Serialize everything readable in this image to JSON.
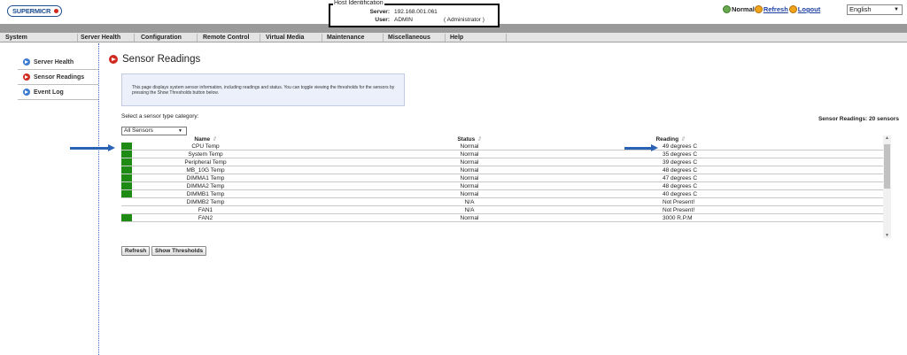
{
  "header": {
    "logo_text": "SUPERMICR",
    "host_box": {
      "legend": "Host Identification",
      "server_label": "Server:",
      "server_value": "192.168.001.061",
      "user_label": "User:",
      "user_value": "ADMIN",
      "user_role": "( Administrator )"
    },
    "status_text": "Normal",
    "refresh_label": "Refresh",
    "logout_label": "Logout",
    "language": "English"
  },
  "nav": [
    "System",
    "Server Health",
    "Configuration",
    "Remote Control",
    "Virtual Media",
    "Maintenance",
    "Miscellaneous",
    "Help"
  ],
  "sidebar": {
    "items": [
      {
        "label": "Server Health",
        "icon": "blue-arrow-icon",
        "active": false
      },
      {
        "label": "Sensor Readings",
        "icon": "red-arrow-icon",
        "active": true
      },
      {
        "label": "Event Log",
        "icon": "blue-arrow-icon",
        "active": false
      }
    ]
  },
  "main": {
    "title": "Sensor Readings",
    "info_text": "This page displays system sensor information, including readings and status. You can toggle viewing the thresholds for the sensors by pressing the Show Thresholds button below.",
    "category_label": "Select a sensor type category:",
    "category_selected": "All Sensors",
    "sensor_count": "Sensor Readings: 20 sensors",
    "columns": {
      "name": "Name",
      "status": "Status",
      "reading": "Reading",
      "sort_icon": "⇕"
    },
    "rows": [
      {
        "name": "CPU Temp",
        "status": "Normal",
        "reading": "49 degrees C",
        "indicator": "green"
      },
      {
        "name": "System Temp",
        "status": "Normal",
        "reading": "35 degrees C",
        "indicator": "green"
      },
      {
        "name": "Peripheral Temp",
        "status": "Normal",
        "reading": "39 degrees C",
        "indicator": "green"
      },
      {
        "name": "MB_10G Temp",
        "status": "Normal",
        "reading": "48 degrees C",
        "indicator": "green"
      },
      {
        "name": "DIMMA1 Temp",
        "status": "Normal",
        "reading": "47 degrees C",
        "indicator": "green"
      },
      {
        "name": "DIMMA2 Temp",
        "status": "Normal",
        "reading": "48 degrees C",
        "indicator": "green"
      },
      {
        "name": "DIMMB1 Temp",
        "status": "Normal",
        "reading": "40 degrees C",
        "indicator": "green"
      },
      {
        "name": "DIMMB2 Temp",
        "status": "N/A",
        "reading": "Not Present!",
        "indicator": "none"
      },
      {
        "name": "FAN1",
        "status": "N/A",
        "reading": "Not Present!",
        "indicator": "none"
      },
      {
        "name": "FAN2",
        "status": "Normal",
        "reading": "3000 R.P.M",
        "indicator": "green"
      }
    ],
    "buttons": {
      "refresh": "Refresh",
      "show_thresholds": "Show Thresholds"
    }
  },
  "colors": {
    "indicator_green": "#1e8c14",
    "annotation_arrow": "#2a62b5",
    "nav_bg": "#e4e4e4",
    "strip_gray": "#9a9a9a",
    "active_icon_red": "#d02a1f",
    "inactive_icon_blue": "#3c7bd0"
  }
}
